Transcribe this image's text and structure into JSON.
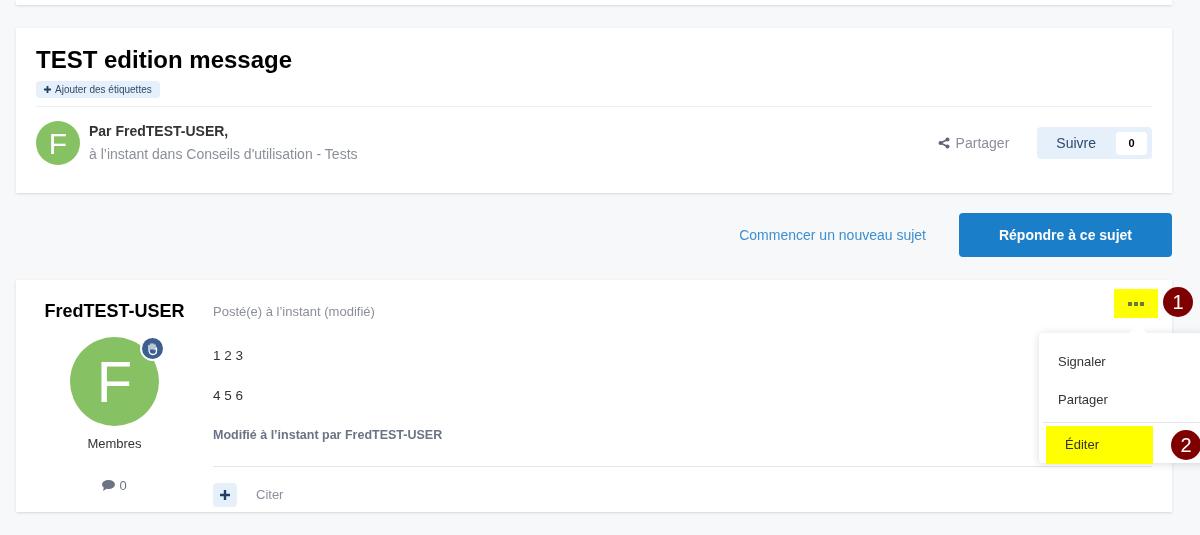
{
  "topic": {
    "title": "TEST edition message",
    "add_tags": "Ajouter des étiquettes",
    "author_line": "Par FredTEST-USER,",
    "meta": "à l’instant dans Conseils d'utilisation - Tests",
    "avatar_letter": "F",
    "share": "Partager",
    "follow": {
      "label": "Suivre",
      "count": "0"
    }
  },
  "actions": {
    "new_topic": "Commencer un nouveau sujet",
    "reply": "Répondre à ce sujet"
  },
  "post": {
    "author": "FredTEST-USER",
    "avatar_letter": "F",
    "group": "Membres",
    "post_count": "0",
    "posted": "Posté(e) à l’instant (modifié)",
    "paragraphs": [
      "1 2 3",
      "4 5 6"
    ],
    "edited_note": "Modifié à l’instant par FredTEST-USER",
    "quote": "Citer",
    "more_button": {
      "highlighted": true
    }
  },
  "menu": {
    "items": [
      {
        "label": "Signaler",
        "highlighted": false
      },
      {
        "label": "Partager",
        "highlighted": false
      },
      {
        "label": "Éditer",
        "highlighted": true
      }
    ]
  },
  "annotations": [
    {
      "label": "1"
    },
    {
      "label": "2"
    }
  ]
}
